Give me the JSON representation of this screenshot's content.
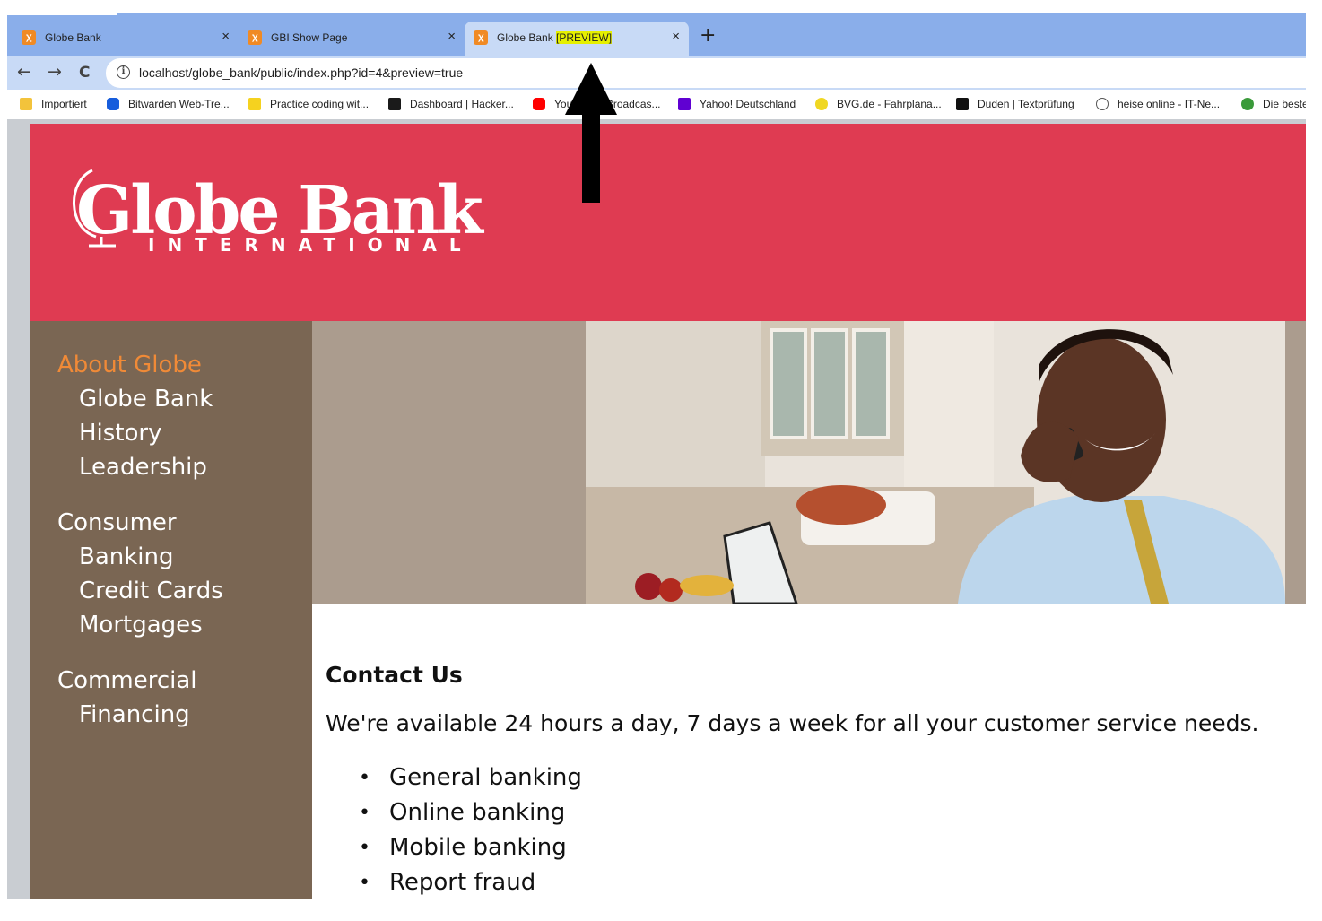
{
  "browser": {
    "tabs": [
      {
        "title": "Globe Bank",
        "highlight": ""
      },
      {
        "title": "GBI Show Page",
        "highlight": ""
      },
      {
        "title": "Globe Bank ",
        "highlight": "[PREVIEW]"
      }
    ],
    "tab_close": "×",
    "new_tab": "+",
    "nav": {
      "back": "←",
      "forward": "→",
      "reload": "C"
    },
    "url": "localhost/globe_bank/public/index.php?id=4&preview=true",
    "bookmarks": [
      {
        "label": "Importiert",
        "icon": "folder-icon",
        "color": "#f3c33b"
      },
      {
        "label": "Bitwarden Web-Tre...",
        "icon": "bitwarden-icon",
        "color": "#175ddc"
      },
      {
        "label": "Practice coding wit...",
        "icon": "codewars-icon",
        "color": "#f5d21f"
      },
      {
        "label": "Dashboard | Hacker...",
        "icon": "hackerrank-icon",
        "color": "#1a1a1a"
      },
      {
        "label": "YouTube - Broadcas...",
        "icon": "youtube-icon",
        "color": "#ff0000"
      },
      {
        "label": "Yahoo! Deutschland",
        "icon": "yahoo-icon",
        "color": "#6001d2"
      },
      {
        "label": "BVG.de - Fahrplana...",
        "icon": "bvg-icon",
        "color": "#f0d722"
      },
      {
        "label": "Duden | Textprüfung",
        "icon": "duden-icon",
        "color": "#111111"
      },
      {
        "label": "heise online - IT-Ne...",
        "icon": "heise-icon",
        "color": "#555555"
      },
      {
        "label": "Die beste",
        "icon": "chefkoch-icon",
        "color": "#3a9a3a"
      }
    ]
  },
  "site": {
    "logo_main": "Globe Bank",
    "logo_sub": "INTERNATIONAL",
    "colors": {
      "header": "#df3b52",
      "sidebar": "#7a6653",
      "selected_subject": "#f08a37"
    },
    "navigation": [
      {
        "subject": "About Globe",
        "selected": true,
        "pages": [
          "Globe Bank",
          "History",
          "Leadership"
        ]
      },
      {
        "subject": "Consumer",
        "selected": false,
        "pages": [
          "Banking",
          "Credit Cards",
          "Mortgages"
        ]
      },
      {
        "subject": "Commercial",
        "selected": false,
        "pages": [
          "Financing"
        ]
      }
    ],
    "content": {
      "heading": "Contact Us",
      "lede": "We're available 24 hours a day, 7 days a week for all your customer service needs.",
      "items": [
        "General banking",
        "Online banking",
        "Mobile banking",
        "Report fraud"
      ]
    }
  }
}
